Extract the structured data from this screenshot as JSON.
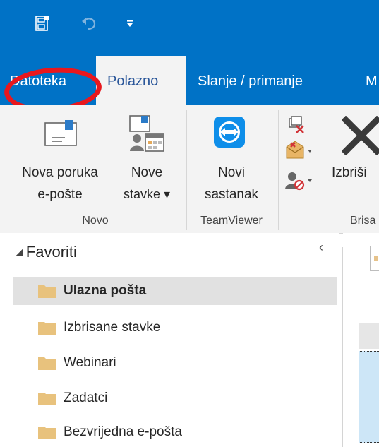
{
  "quick_access": {
    "icons": [
      "save-icon",
      "undo-icon",
      "customize-quick-access-icon"
    ]
  },
  "tabs": [
    {
      "label": "Datoteka",
      "active": false
    },
    {
      "label": "Polazno",
      "active": true
    },
    {
      "label": "Slanje / primanje",
      "active": false
    },
    {
      "label": "M",
      "active": false
    }
  ],
  "ribbon": {
    "groups": [
      {
        "label": "Novo"
      },
      {
        "label": "TeamViewer"
      },
      {
        "label": "Brisa"
      }
    ],
    "buttons": {
      "new_email": {
        "line1": "Nova poruka",
        "line2": "e-pošte"
      },
      "new_items": {
        "line1": "Nove",
        "line2": "stavke ▾"
      },
      "new_meeting": {
        "line1": "Novi",
        "line2": "sastanak"
      },
      "delete": {
        "label": "Izbriši"
      }
    }
  },
  "navigation": {
    "favorites_label": "Favoriti",
    "folders": [
      {
        "label": "Ulazna pošta",
        "selected": true
      },
      {
        "label": "Izbrisane stavke",
        "selected": false
      },
      {
        "label": "Webinari",
        "selected": false
      },
      {
        "label": "Zadatci",
        "selected": false
      },
      {
        "label": "Bezvrijedna e-pošta",
        "selected": false
      }
    ]
  },
  "colors": {
    "brand_blue": "#0072c6",
    "annotation_red": "#e8171d",
    "folder_yellow": "#e8c27d",
    "selection_gray": "#e1e1e1"
  }
}
